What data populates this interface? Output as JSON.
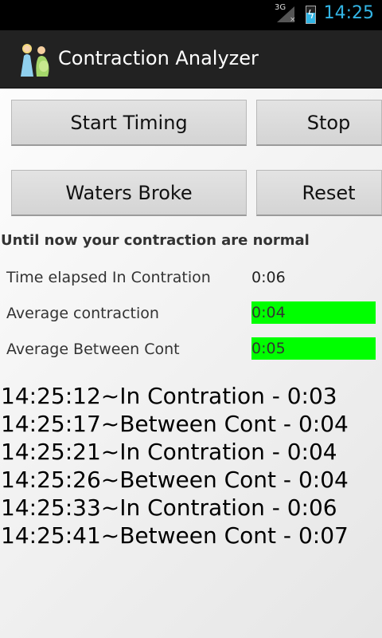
{
  "status_bar": {
    "network": "3G",
    "time": "14:25"
  },
  "app": {
    "title": "Contraction Analyzer"
  },
  "buttons": {
    "start": "Start Timing",
    "stop": "Stop",
    "waters": "Waters Broke",
    "reset": "Reset"
  },
  "status_message": "Until now your contraction are normal",
  "stats": {
    "elapsed_label": "Time elapsed In Contration",
    "elapsed_value": "0:06",
    "avg_contraction_label": "Average contraction",
    "avg_contraction_value": "0:04",
    "avg_between_label": "Average Between Cont",
    "avg_between_value": "0:05",
    "highlight_color": "#00ff00"
  },
  "log": [
    "14:25:12~In Contration - 0:03",
    "14:25:17~Between Cont - 0:04",
    "14:25:21~In Contration - 0:04",
    "14:25:26~Between Cont - 0:04",
    "14:25:33~In Contration - 0:06",
    "14:25:41~Between Cont - 0:07"
  ]
}
